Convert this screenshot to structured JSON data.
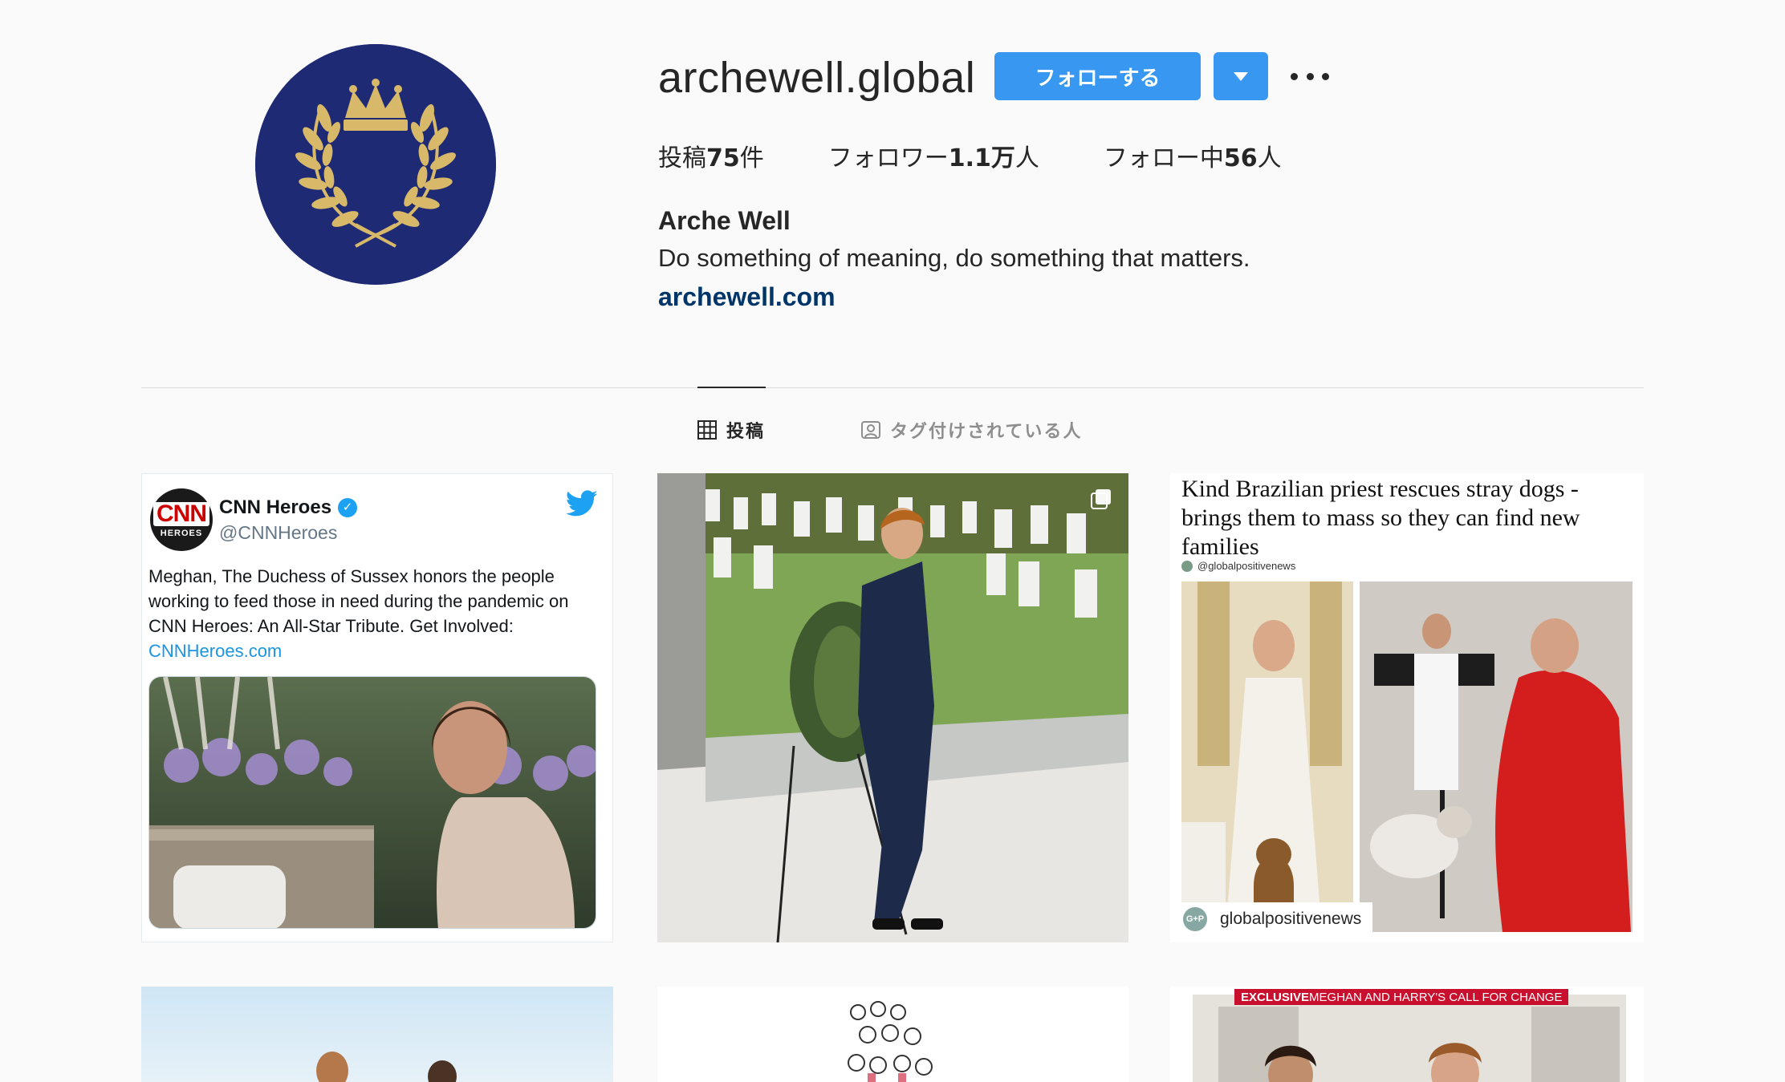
{
  "profile": {
    "username": "archewell.global",
    "follow_label": "フォローする",
    "display_name": "Arche Well",
    "bio": "Do something of meaning, do something that matters.",
    "website": "archewell.com",
    "stats": {
      "posts_prefix": "投稿",
      "posts_count": "75",
      "posts_suffix": "件",
      "followers_prefix": "フォロワー",
      "followers_count": "1.1万",
      "followers_suffix": "人",
      "following_prefix": "フォロー中",
      "following_count": "56",
      "following_suffix": "人"
    }
  },
  "tabs": {
    "posts": "投稿",
    "tagged": "タグ付けされている人"
  },
  "posts": {
    "tweet": {
      "name": "CNN Heroes",
      "handle": "@CNNHeroes",
      "text": "Meghan, The Duchess of Sussex honors the people working to feed those in need during the pandemic on CNN Heroes: An All-Star Tribute. Get Involved: ",
      "link": "CNNHeroes.com",
      "logo_top": "CNN",
      "logo_bottom": "HEROES"
    },
    "priest": {
      "title": "Kind Brazilian priest rescues stray dogs - brings them to mass so they can find new families",
      "handle": "@globalpositivenews",
      "tag": "globalpositivenews",
      "tag_logo": "G+P"
    },
    "exclusive_banner": {
      "prefix": "EXCLUSIVE",
      "text": " MEGHAN AND HARRY'S CALL FOR CHANGE"
    }
  },
  "colors": {
    "follow_blue": "#3897f0",
    "avatar_navy": "#1f2a74",
    "crest_gold": "#d8b96a",
    "link_navy": "#003569"
  },
  "icons": [
    "crest-logo-icon",
    "chevron-down-icon",
    "more-icon",
    "grid-icon",
    "tagged-person-icon",
    "verified-icon",
    "twitter-bird-icon",
    "multi-post-icon"
  ]
}
